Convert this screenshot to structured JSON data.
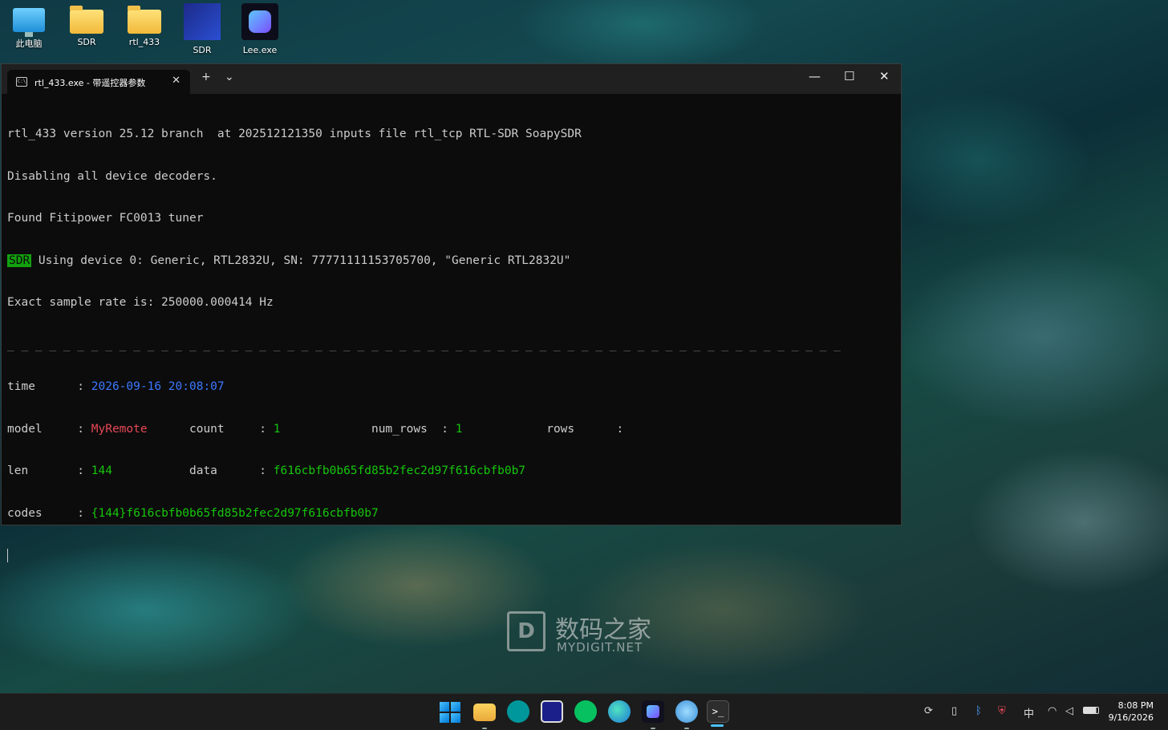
{
  "desktop": {
    "icons": [
      {
        "label": "此电脑",
        "icon": "computer-icon"
      },
      {
        "label": "SDR",
        "icon": "folder-icon"
      },
      {
        "label": "rtl_433",
        "icon": "folder-icon"
      },
      {
        "label": "SDR",
        "icon": "sdr-shortcut-icon"
      },
      {
        "label": "Lee.exe",
        "icon": "app-icon"
      }
    ]
  },
  "window": {
    "tab_title": "rtl_433.exe - 带遥控器参数",
    "tab_icon": "terminal-icon",
    "new_tab_label": "+",
    "dropdown_label": "⌄",
    "minimize_label": "—",
    "maximize_label": "☐",
    "close_label": "✕"
  },
  "terminal": {
    "line1": "rtl_433 version 25.12 branch  at 202512121350 inputs file rtl_tcp RTL-SDR SoapySDR",
    "line2": "Disabling all device decoders.",
    "line3": "Found Fitipower FC0013 tuner",
    "sdr_tag": "SDR",
    "line4": " Using device 0: Generic, RTL2832U, SN: 77771111153705700, \"Generic RTL2832U\"",
    "line5": "Exact sample rate is: 250000.000414 Hz",
    "separator": "_ _ _ _ _ _ _ _ _ _ _ _ _ _ _ _ _ _ _ _ _ _ _ _ _ _ _ _ _ _ _ _ _ _ _ _ _ _ _ _ _ _ _ _ _ _ _ _ _ _ _ _ _ _ _ _ _ _ _ _",
    "time_label": "time      : ",
    "time_value": "2026-09-16 20:08:07",
    "model_label": "model     : ",
    "model_value": "MyRemote",
    "count_label": "      count     : ",
    "count_value": "1",
    "num_rows_label": "             num_rows  : ",
    "num_rows_value": "1",
    "rows_label": "            rows      :",
    "len_label": "len       : ",
    "len_value": "144",
    "data_label": "           data      : ",
    "data_value": "f616cbfb0b65fd85b2fec2d97f616cbfb0b7",
    "codes_label": "codes     : ",
    "codes_value": "{144}f616cbfb0b65fd85b2fec2d97f616cbfb0b7"
  },
  "watermark": {
    "logo_letter": "D",
    "text_cn": "数码之家",
    "text_en": "MYDIGIT.NET"
  },
  "taskbar": {
    "apps": [
      "windows-start-icon",
      "file-explorer-icon",
      "arduino-icon",
      "oscilloscope-icon",
      "wechat-icon",
      "edge-icon",
      "lee-app-icon",
      "globe-app-icon",
      "terminal-icon"
    ],
    "tray_ime": "中",
    "clock_time": "8:08 PM",
    "clock_date": "9/16/2026"
  },
  "colors": {
    "terminal_bg": "#0c0c0c",
    "sdr_tag_bg": "#13a10e",
    "time_value": "#3b78ff",
    "model_value": "#e74856",
    "value_green": "#16c60c"
  }
}
